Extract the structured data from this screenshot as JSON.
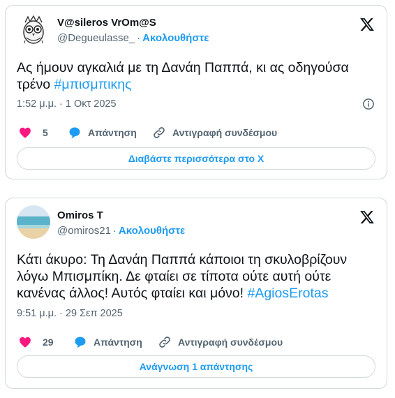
{
  "tweets": [
    {
      "author_name": "V@sileros VrOm@S",
      "handle": "@Degueulasse_",
      "separator": "·",
      "follow_label": "Ακολουθήστε",
      "text": "Ας ήμουν αγκαλιά με τη Δανάη Παππά, κι ας οδηγούσα τρένο ",
      "hashtag": "#μπισμπικης",
      "timestamp": "1:52 μ.μ. · 1 Οκτ 2025",
      "like_count": "5",
      "reply_label": "Απάντηση",
      "copy_link_label": "Αντιγραφή συνδέσμου",
      "footer_button_label": "Διαβάστε περισσότερα στο X",
      "avatar_icon": "owl-sketch-avatar"
    },
    {
      "author_name": "Omiros T",
      "handle": "@omiros21",
      "separator": "·",
      "follow_label": "Ακολουθήστε",
      "text": "Κάτι άκυρο: Τη Δανάη Παππά κάποιοι τη σκυλοβρίζουν λόγω Μπισμπίκη. Δε φταίει σε τίποτα ούτε αυτή ούτε κανένας άλλος! Αυτός φταίει και μόνο! ",
      "hashtag": "#AgiosErotas",
      "timestamp": "9:51 μ.μ. · 29 Σεπ 2025",
      "like_count": "29",
      "reply_label": "Απάντηση",
      "copy_link_label": "Αντιγραφή συνδέσμου",
      "footer_button_label": "Ανάγνωση 1 απάντησης",
      "avatar_icon": "beach-photo-avatar"
    }
  ],
  "colors": {
    "accent": "#1d9bf0",
    "like": "#f91880",
    "secondary_text": "#536471",
    "border": "#cfd9de"
  }
}
